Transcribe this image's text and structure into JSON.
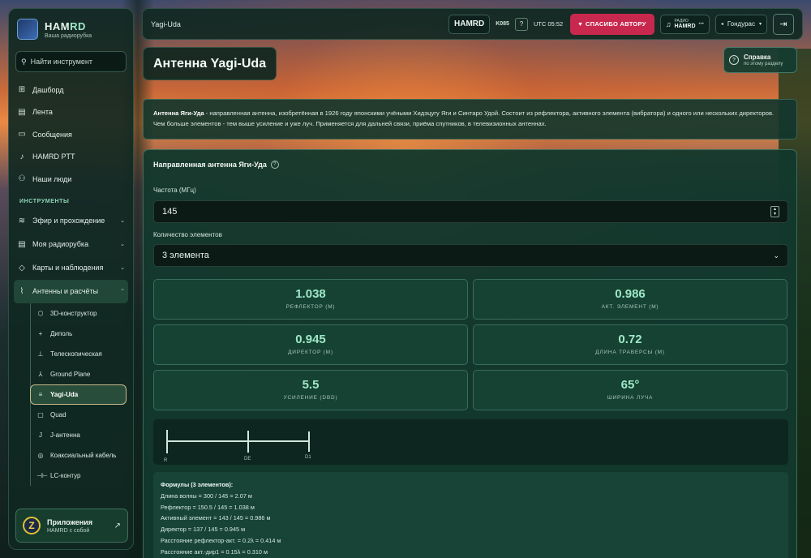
{
  "sidebar": {
    "logo_main": "HAM",
    "logo_accent": "RD",
    "logo_sub": "Ваша радиорубка",
    "search_placeholder": "Найти инструмент",
    "nav": [
      {
        "label": "Дашборд",
        "icon": "dashboard-icon"
      },
      {
        "label": "Лента",
        "icon": "feed-icon"
      },
      {
        "label": "Сообщения",
        "icon": "messages-icon"
      },
      {
        "label": "HAMRD PTT",
        "icon": "ptt-icon"
      },
      {
        "label": "Наши люди",
        "icon": "people-icon"
      }
    ],
    "section_tools": "ИНСТРУМЕНТЫ",
    "groups": [
      {
        "label": "Эфир и прохождение"
      },
      {
        "label": "Моя радиорубка"
      },
      {
        "label": "Карты и наблюдения"
      },
      {
        "label": "Антенны и расчёты"
      }
    ],
    "sub_items": [
      {
        "label": "3D-конструктор"
      },
      {
        "label": "Диполь"
      },
      {
        "label": "Телескопическая"
      },
      {
        "label": "Ground Plane"
      },
      {
        "label": "Yagi-Uda"
      },
      {
        "label": "Quad"
      },
      {
        "label": "J-антенна"
      },
      {
        "label": "Коаксиальный кабель"
      },
      {
        "label": "LC-контур"
      }
    ],
    "apps_title": "Приложения",
    "apps_sub": "HAMRD с собой",
    "apps_logo": "Z"
  },
  "topbar": {
    "breadcrumb": "Yagi-Uda",
    "brand": "HAMRD",
    "callsign": "K085",
    "help_q": "?",
    "utc": "UTC 05:52",
    "thanks": "СПАСИБО АВТОРУ",
    "radio_top": "РАДИО",
    "radio_main": "HAMRD",
    "radio_dots": "•••",
    "country": "Гондурас"
  },
  "page": {
    "title": "Антенна Yagi-Uda",
    "help_title": "Справка",
    "help_sub": "по этому разделу",
    "desc_bold": "Антенна Яги-Уда",
    "desc_text": " - направленная антенна, изобретённая в 1926 году японскими учёными Хидэцугу Яги и Синтаро Удой. Состоит из рефлектора, активного элемента (вибратора) и одного или нескольких директоров. Чем больше элементов - тем выше усиление и уже луч. Применяется для дальней связи, приёма спутников, в телевизионных антеннах."
  },
  "calc": {
    "title": "Направленная антенна Яги-Уда",
    "freq_label": "Частота (МГц)",
    "freq_value": "145",
    "elements_label": "Количество элементов",
    "elements_value": "3 элемента",
    "results": [
      {
        "value": "1.038",
        "key": "РЕФЛЕКТОР (М)"
      },
      {
        "value": "0.986",
        "key": "АКТ. ЭЛЕМЕНТ (М)"
      },
      {
        "value": "0.945",
        "key": "ДИРЕКТОР (М)"
      },
      {
        "value": "0.72",
        "key": "ДЛИНА ТРАВЕРСЫ (М)"
      },
      {
        "value": "5.5",
        "key": "УСИЛЕНИЕ (DBD)"
      },
      {
        "value": "65°",
        "key": "ШИРИНА ЛУЧА"
      }
    ],
    "diagram_labels": [
      "R",
      "DE",
      "D1"
    ],
    "formulas_title": "Формулы (3 элементов):",
    "formulas": [
      "Длина волны = 300 / 145 = 2.07 м",
      "Рефлектор = 150.5 / 145 = 1.038 м",
      "Активный элемент = 143 / 145 = 0.986 м",
      "Директор = 137 / 145 = 0.945 м",
      "Расстояние рефлектор-акт. = 0.2λ = 0.414 м",
      "Расстояние акт.-дир1 = 0.15λ = 0.310 м"
    ]
  },
  "colors": {
    "accent": "#9fe7c8",
    "thanks": "#c8284e",
    "active_border": "#c9b98a"
  }
}
